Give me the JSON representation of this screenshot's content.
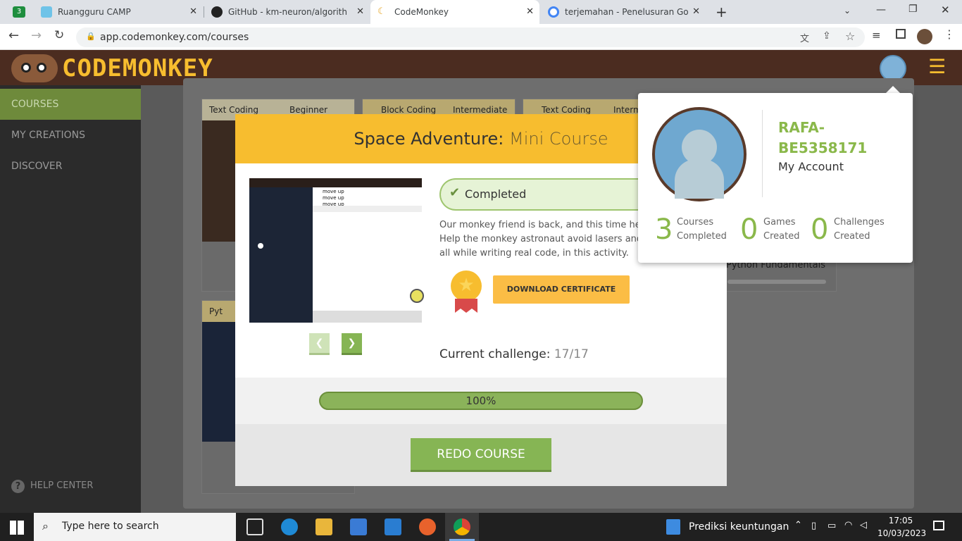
{
  "browser": {
    "tabs": [
      {
        "title": "Ruangguru CAMP",
        "active": false
      },
      {
        "title": "GitHub - km-neuron/algorithm-a",
        "active": false
      },
      {
        "title": "CodeMonkey",
        "active": true
      },
      {
        "title": "terjemahan - Penelusuran Google",
        "active": false
      }
    ],
    "url": "app.codemonkey.com/courses",
    "notification_count": "3"
  },
  "app": {
    "logo_text": "CODEMONKEY",
    "brand_colors": {
      "header": "#4b2c20",
      "accent": "#f7bd2f",
      "green": "#86b554"
    }
  },
  "sidebar": {
    "items": [
      {
        "label": "COURSES",
        "active": true
      },
      {
        "label": "MY CREATIONS",
        "active": false
      },
      {
        "label": "DISCOVER",
        "active": false
      }
    ],
    "help_label": "HELP CENTER"
  },
  "background_cards": [
    {
      "type": "Text Coding",
      "level": "Beginner"
    },
    {
      "type": "Block Coding",
      "level": "Intermediate"
    },
    {
      "type": "Text Coding",
      "level": "Interm"
    },
    {
      "type": "Pyt",
      "level": ""
    }
  ],
  "background_course_title": "Python Fundamentals",
  "modal": {
    "title_bold": "Space Adventure:",
    "title_light": "Mini Course",
    "status": "Completed",
    "description": "Our monkey friend is back, and this time he's\nHelp the monkey astronaut avoid lasers and\nall while writing real code, in this activity.",
    "download_label": "DOWNLOAD CERTIFICATE",
    "challenge_label": "Current challenge:",
    "challenge_value": "17/17",
    "progress": 1.0,
    "progress_text": "100%",
    "redo_label": "REDO COURSE",
    "code_lines": [
      "move up",
      "move up",
      "move up"
    ]
  },
  "profile": {
    "username": "RAFA-\nBE5358171",
    "account_label": "My Account",
    "stats": [
      {
        "value": "3",
        "label": "Courses\nCompleted"
      },
      {
        "value": "0",
        "label": "Games\nCreated"
      },
      {
        "value": "0",
        "label": "Challenges\nCreated"
      }
    ]
  },
  "taskbar": {
    "search_placeholder": "Type here to search",
    "open_app": "Prediksi keuntungan",
    "time": "17:05",
    "date": "10/03/2023"
  }
}
